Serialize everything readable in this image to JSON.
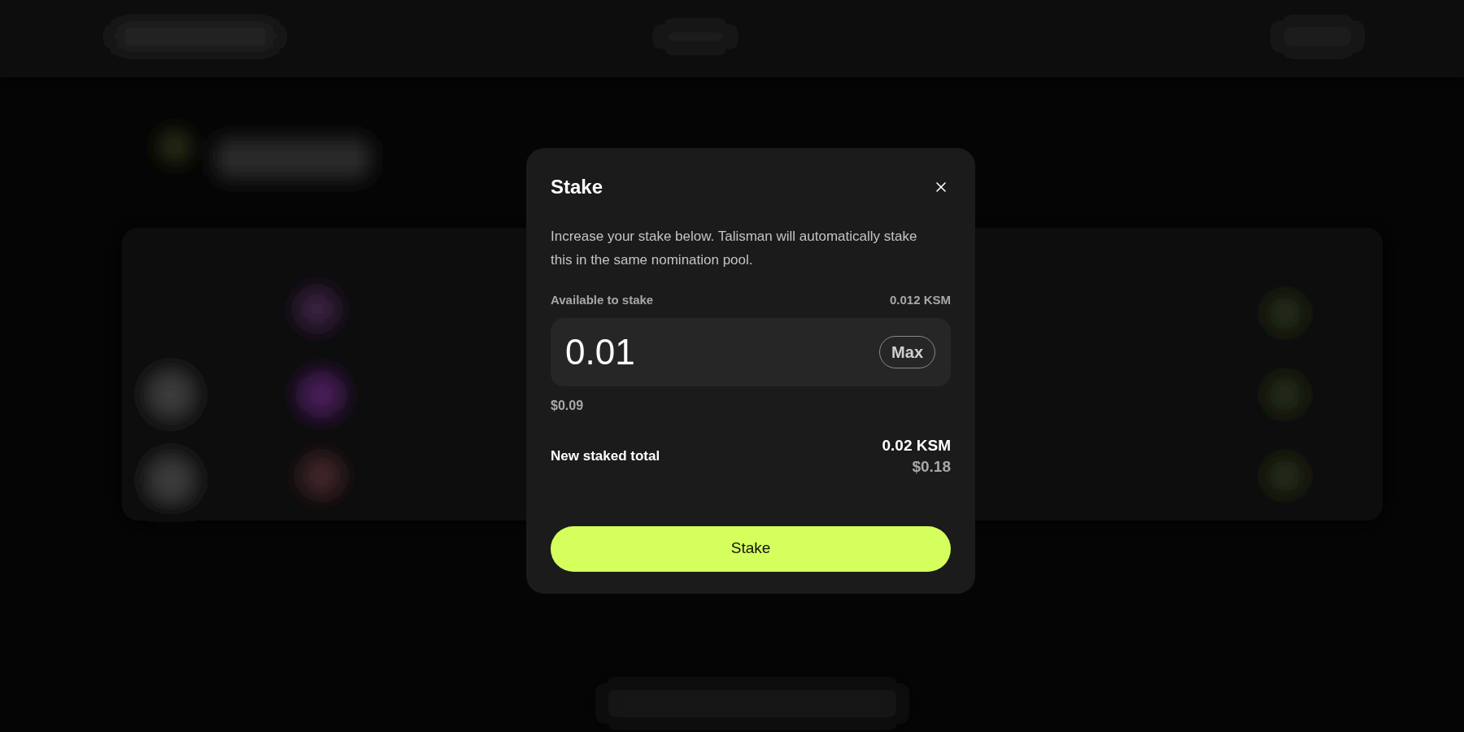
{
  "dialog": {
    "title": "Stake",
    "description": "Increase your stake below. Talisman will automatically stake this in the same nomination pool.",
    "available_label": "Available to stake",
    "available_value": "0.012 KSM",
    "amount_field": {
      "value": "0.01",
      "max_button": "Max"
    },
    "amount_fiat": "$0.09",
    "total_label": "New staked total",
    "total_value": "0.02 KSM",
    "total_fiat": "$0.18",
    "submit_button": "Stake"
  }
}
